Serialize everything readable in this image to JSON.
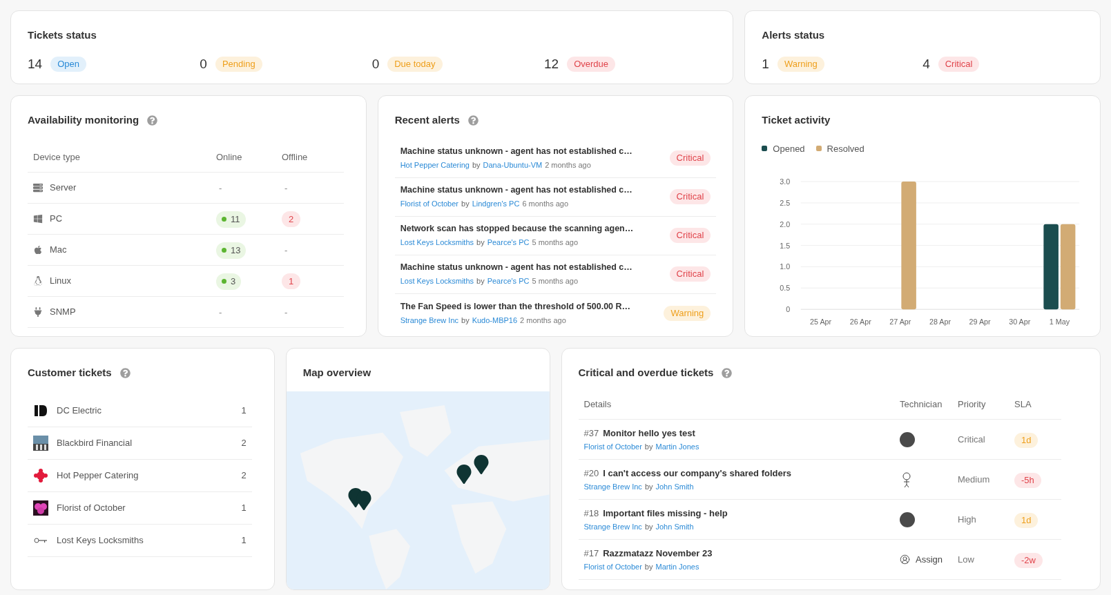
{
  "tickets_status": {
    "title": "Tickets status",
    "items": [
      {
        "count": "14",
        "label": "Open",
        "kind": "info"
      },
      {
        "count": "0",
        "label": "Pending",
        "kind": "warning"
      },
      {
        "count": "0",
        "label": "Due today",
        "kind": "warning"
      },
      {
        "count": "12",
        "label": "Overdue",
        "kind": "critical"
      }
    ]
  },
  "alerts_status": {
    "title": "Alerts status",
    "items": [
      {
        "count": "1",
        "label": "Warning",
        "kind": "warning"
      },
      {
        "count": "4",
        "label": "Critical",
        "kind": "critical"
      }
    ]
  },
  "availability_monitoring": {
    "title": "Availability monitoring",
    "columns": [
      "Device type",
      "Online",
      "Offline"
    ],
    "rows": [
      {
        "device": "Server",
        "online": {
          "text": "-",
          "kind": "none"
        },
        "offline": {
          "text": "-",
          "kind": "none"
        }
      },
      {
        "device": "PC",
        "online": {
          "text": "11",
          "kind": "online"
        },
        "offline": {
          "text": "2",
          "kind": "offline"
        }
      },
      {
        "device": "Mac",
        "online": {
          "text": "13",
          "kind": "online"
        },
        "offline": {
          "text": "-",
          "kind": "none"
        }
      },
      {
        "device": "Linux",
        "online": {
          "text": "3",
          "kind": "online"
        },
        "offline": {
          "text": "1",
          "kind": "offline"
        }
      },
      {
        "device": "SNMP",
        "online": {
          "text": "-",
          "kind": "none"
        },
        "offline": {
          "text": "-",
          "kind": "none"
        }
      }
    ]
  },
  "recent_alerts": {
    "title": "Recent alerts",
    "rows": [
      {
        "message": "Machine status unknown - agent has not established c…",
        "customer": "Hot Pepper Catering",
        "by": "by",
        "device": "Dana-Ubuntu-VM",
        "time": "2 months ago",
        "severity": "Critical",
        "kind": "critical"
      },
      {
        "message": "Machine status unknown - agent has not established c…",
        "customer": "Florist of October",
        "by": "by",
        "device": "Lindgren's PC",
        "time": "6 months ago",
        "severity": "Critical",
        "kind": "critical"
      },
      {
        "message": "Network scan has stopped because the scanning agen…",
        "customer": "Lost Keys Locksmiths",
        "by": "by",
        "device": "Pearce's PC",
        "time": "5 months ago",
        "severity": "Critical",
        "kind": "critical"
      },
      {
        "message": "Machine status unknown - agent has not established c…",
        "customer": "Lost Keys Locksmiths",
        "by": "by",
        "device": "Pearce's PC",
        "time": "5 months ago",
        "severity": "Critical",
        "kind": "critical"
      },
      {
        "message": "The Fan Speed is lower than the threshold of 500.00 R…",
        "customer": "Strange Brew Inc",
        "by": "by",
        "device": "Kudo-MBP16",
        "time": "2 months ago",
        "severity": "Warning",
        "kind": "warning"
      }
    ]
  },
  "ticket_activity": {
    "title": "Ticket activity",
    "chart_data": {
      "type": "bar",
      "categories": [
        "25 Apr",
        "26 Apr",
        "27 Apr",
        "28 Apr",
        "29 Apr",
        "30 Apr",
        "1 May"
      ],
      "series": [
        {
          "name": "Opened",
          "color": "#1b4d4f",
          "values": [
            0,
            0,
            0,
            0,
            0,
            0,
            2
          ]
        },
        {
          "name": "Resolved",
          "color": "#d2ab74",
          "values": [
            0,
            0,
            3,
            0,
            0,
            0,
            2
          ]
        }
      ],
      "grid": true,
      "ylim": [
        0,
        3
      ],
      "yticks": [
        {
          "value": 0,
          "label": "0"
        },
        {
          "value": 0.5,
          "label": "0.5"
        },
        {
          "value": 1,
          "label": "1.0"
        },
        {
          "value": 1.5,
          "label": "1.5"
        },
        {
          "value": 2,
          "label": "2.0"
        },
        {
          "value": 2.5,
          "label": "2.5"
        },
        {
          "value": 3,
          "label": "3.0"
        }
      ]
    }
  },
  "customer_tickets": {
    "title": "Customer tickets",
    "rows": [
      {
        "name": "DC Electric",
        "count": "1"
      },
      {
        "name": "Blackbird Financial",
        "count": "2"
      },
      {
        "name": "Hot Pepper Catering",
        "count": "2"
      },
      {
        "name": "Florist of October",
        "count": "1"
      },
      {
        "name": "Lost Keys Locksmiths",
        "count": "1"
      }
    ]
  },
  "map_overview": {
    "title": "Map overview"
  },
  "critical_overdue_tickets": {
    "title": "Critical and overdue tickets",
    "columns": [
      "Details",
      "Technician",
      "Priority",
      "SLA"
    ],
    "rows": [
      {
        "number": "#37",
        "subject": "Monitor hello yes test",
        "customer": "Florist of October",
        "by": "by",
        "requester": "Martin Jones",
        "priority": "Critical",
        "sla": {
          "text": "1d",
          "kind": "warning"
        }
      },
      {
        "number": "#20",
        "subject": "I can't access our company's shared folders",
        "customer": "Strange Brew Inc",
        "by": "by",
        "requester": "John Smith",
        "technician": {
          "kind": "sketch"
        },
        "priority": "Medium",
        "sla": {
          "text": "-5h",
          "kind": "critical"
        }
      },
      {
        "number": "#18",
        "subject": "Important files missing - help",
        "customer": "Strange Brew Inc",
        "by": "by",
        "requester": "John Smith",
        "priority": "High",
        "sla": {
          "text": "1d",
          "kind": "warning"
        }
      },
      {
        "number": "#17",
        "subject": "Razzmatazz November 23",
        "customer": "Florist of October",
        "by": "by",
        "requester": "Martin Jones",
        "technician": {
          "kind": "unassigned",
          "label": "Assign"
        },
        "priority": "Low",
        "sla": {
          "text": "-2w",
          "kind": "critical"
        }
      }
    ]
  }
}
